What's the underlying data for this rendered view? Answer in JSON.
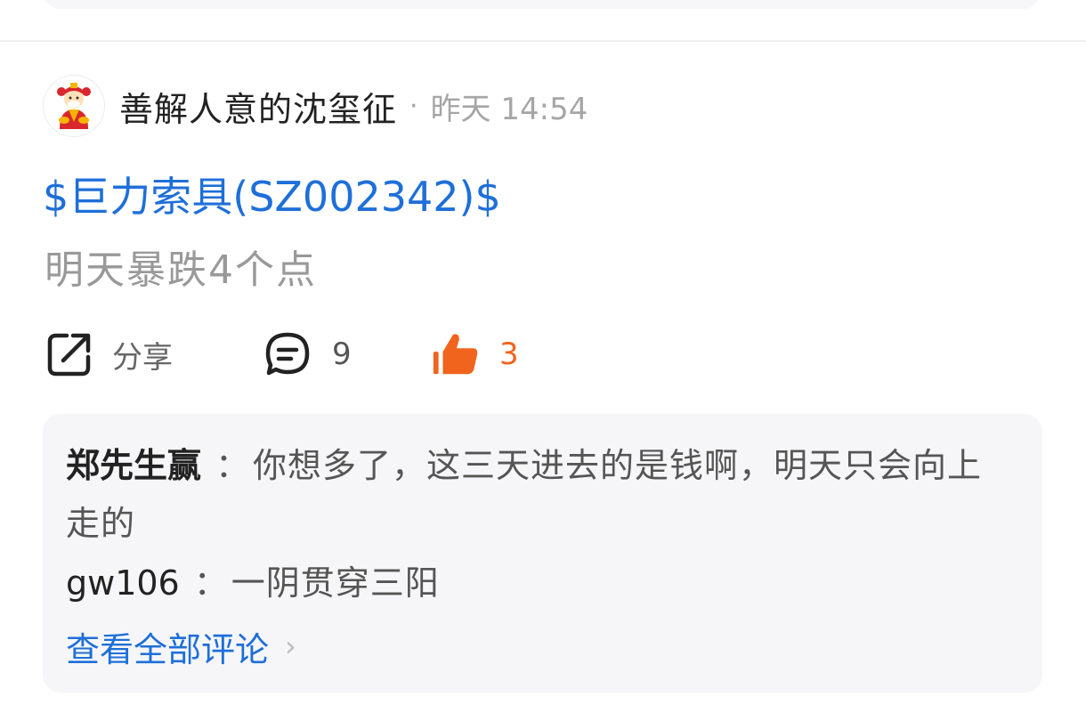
{
  "post": {
    "username": "善解人意的沈玺征",
    "dot": "·",
    "time": "昨天 14:54",
    "stock_link": "$巨力索具(SZ002342)$",
    "text": "明天暴跌4个点"
  },
  "actions": {
    "share_label": "分享",
    "comment_count": "9",
    "like_count": "3"
  },
  "comments": {
    "items": [
      {
        "author": "郑先生赢",
        "separator": "：",
        "text": "你想多了，这三天进去的是钱啊，明天只会向上走的"
      },
      {
        "author": "gw106",
        "separator": "：",
        "text": "一阴贯穿三阳"
      }
    ],
    "view_all_label": "查看全部评论",
    "view_all_chevron": "›"
  },
  "colors": {
    "accent_blue": "#1e6fd9",
    "like_orange": "#f0641e",
    "muted_gray": "#a6a6a6"
  },
  "icons": {
    "share": "share-icon",
    "comment": "comment-icon",
    "like": "thumbs-up-icon",
    "avatar": "avatar"
  }
}
